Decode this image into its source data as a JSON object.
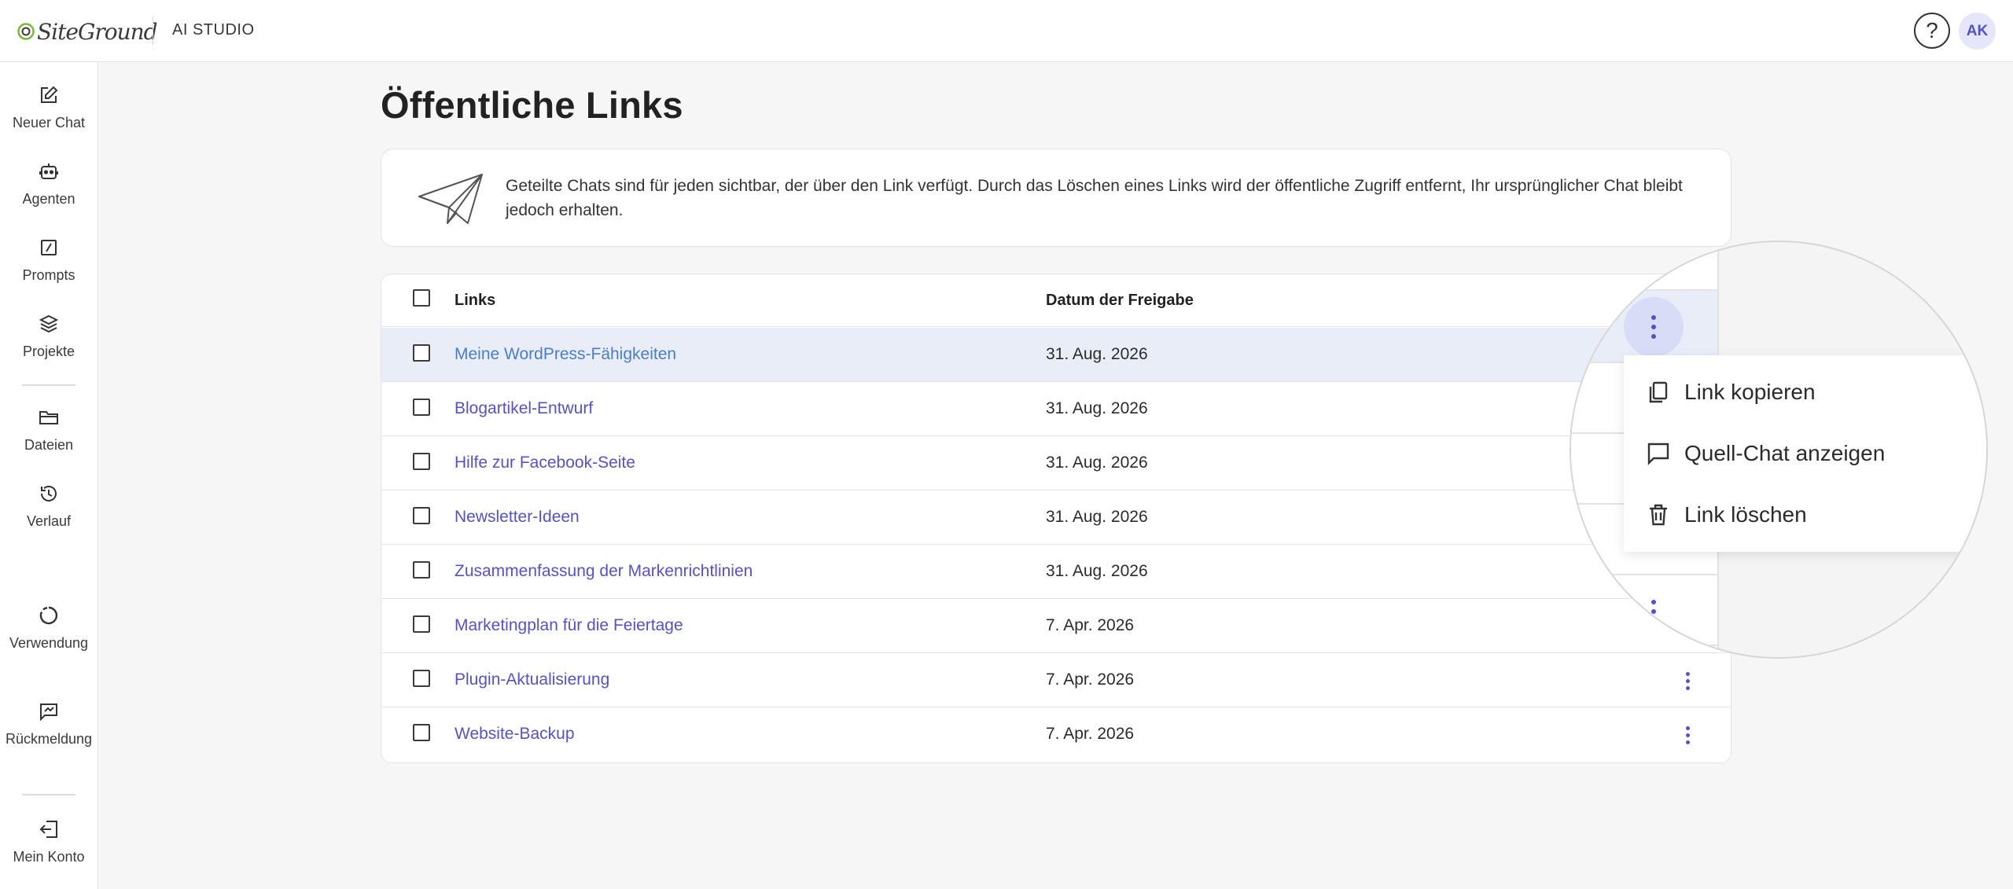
{
  "header": {
    "logo_text": "SiteGround",
    "app_name": "AI STUDIO",
    "help_label": "?",
    "avatar_initials": "AK"
  },
  "sidebar": {
    "items": [
      {
        "label": "Neuer Chat",
        "icon": "edit-icon"
      },
      {
        "label": "Agenten",
        "icon": "robot-icon"
      },
      {
        "label": "Prompts",
        "icon": "prompt-icon"
      },
      {
        "label": "Projekte",
        "icon": "layers-icon"
      },
      {
        "label": "Dateien",
        "icon": "folder-icon"
      },
      {
        "label": "Verlauf",
        "icon": "history-icon"
      },
      {
        "label": "Verwendung",
        "icon": "usage-icon"
      },
      {
        "label": "Rückmeldung",
        "icon": "feedback-icon"
      },
      {
        "label": "Mein Konto",
        "icon": "logout-icon"
      }
    ]
  },
  "main": {
    "title": "Öffentliche Links",
    "info_text": "Geteilte Chats sind für jeden sichtbar, der über den Link verfügt. Durch das Löschen eines Links wird der öffentliche Zugriff entfernt, Ihr ursprünglicher Chat bleibt jedoch erhalten.",
    "table": {
      "col_links": "Links",
      "col_date": "Datum der Freigabe",
      "rows": [
        {
          "name": "Meine WordPress-Fähigkeiten",
          "date": "31. Aug. 2026"
        },
        {
          "name": "Blogartikel-Entwurf",
          "date": "31. Aug. 2026"
        },
        {
          "name": "Hilfe zur Facebook-Seite",
          "date": "31. Aug. 2026"
        },
        {
          "name": "Newsletter-Ideen",
          "date": "31. Aug. 2026"
        },
        {
          "name": "Zusammenfassung der Markenrichtlinien",
          "date": "31. Aug. 2026"
        },
        {
          "name": "Marketingplan für die Feiertage",
          "date": "7. Apr. 2026"
        },
        {
          "name": "Plugin-Aktualisierung",
          "date": "7. Apr. 2026"
        },
        {
          "name": "Website-Backup",
          "date": "7. Apr. 2026"
        }
      ]
    }
  },
  "context_menu": {
    "items": [
      {
        "label": "Link kopieren",
        "icon": "copy-icon"
      },
      {
        "label": "Quell-Chat anzeigen",
        "icon": "chat-icon"
      },
      {
        "label": "Link löschen",
        "icon": "trash-icon"
      }
    ]
  },
  "colors": {
    "accent": "#5452c4",
    "selected_row": "#e9edf8",
    "background": "#f6f6f7"
  }
}
